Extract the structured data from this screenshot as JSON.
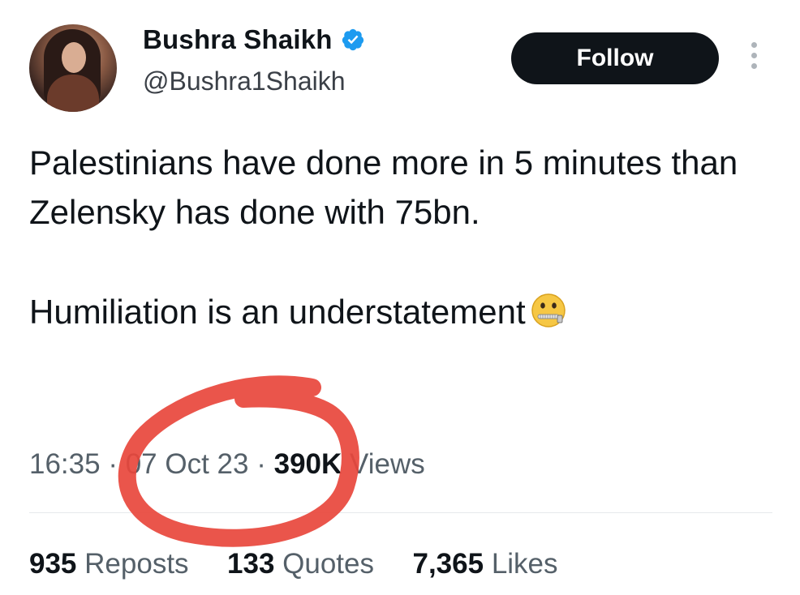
{
  "user": {
    "display_name": "Bushra Shaikh",
    "handle": "@Bushra1Shaikh",
    "verified": true
  },
  "follow_button": {
    "label": "Follow"
  },
  "tweet": {
    "text_line1": "Palestinians have done more in 5 minutes than Zelensky has done with 75bn.",
    "text_line2": "Humiliation is an understatement",
    "emoji": "zipper-mouth-face"
  },
  "meta": {
    "time": "16:35",
    "separator": "·",
    "date": "07 Oct 23",
    "views_count": "390K",
    "views_label": "Views"
  },
  "stats": {
    "reposts_count": "935",
    "reposts_label": "Reposts",
    "quotes_count": "133",
    "quotes_label": "Quotes",
    "likes_count": "7,365",
    "likes_label": "Likes"
  },
  "colors": {
    "follow_bg": "#0f1419",
    "verified": "#1d9bf0",
    "annotation": "#e8473c"
  }
}
